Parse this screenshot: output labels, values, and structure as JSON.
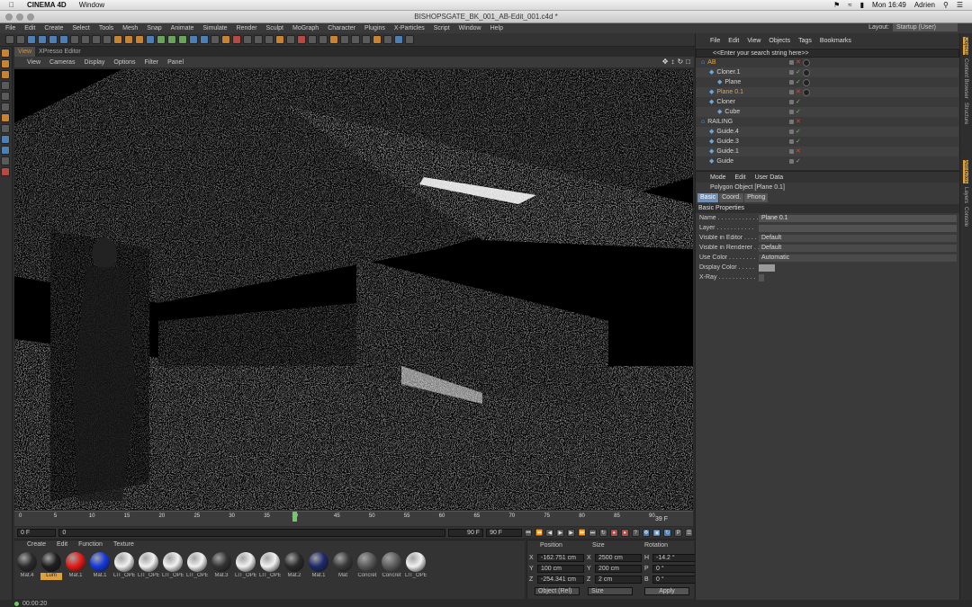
{
  "mac": {
    "app_name": "CINEMA 4D",
    "menu": [
      "Window"
    ],
    "clock": "Mon 16:49",
    "user": "Adrien"
  },
  "window_title": "BISHOPSGATE_BK_001_AB-Edit_001.c4d *",
  "main_menu": [
    "File",
    "Edit",
    "Create",
    "Select",
    "Tools",
    "Mesh",
    "Snap",
    "Animate",
    "Simulate",
    "Render",
    "Sculpt",
    "MoGraph",
    "Character",
    "Plugins",
    "X-Particles",
    "Script",
    "Window",
    "Help"
  ],
  "layout": {
    "label": "Layout:",
    "value": "Startup (User)"
  },
  "viewport": {
    "tabs": [
      "View",
      "XPresso Editor"
    ],
    "menu": [
      "View",
      "Cameras",
      "Display",
      "Options",
      "Filter",
      "Panel"
    ]
  },
  "timeline": {
    "ticks": [
      "0",
      "5",
      "10",
      "15",
      "20",
      "25",
      "30",
      "35",
      "39",
      "45",
      "50",
      "55",
      "60",
      "65",
      "70",
      "75",
      "80",
      "85",
      "90"
    ],
    "current_frame": 39,
    "end_label": "39 F"
  },
  "playback": {
    "start": "0 F",
    "min": "0",
    "max": "90 F",
    "end": "90 F"
  },
  "materials": {
    "menu": [
      "Create",
      "Edit",
      "Function",
      "Texture"
    ],
    "items": [
      {
        "name": "Mat.4",
        "color": "#2a2a2a"
      },
      {
        "name": "Lum",
        "color": "#1e1e1e",
        "selected": true
      },
      {
        "name": "Mat.1",
        "color": "#e41b17"
      },
      {
        "name": "Mat.1",
        "color": "#1438e0"
      },
      {
        "name": "LIT_OPE",
        "color": "#f2f2f2"
      },
      {
        "name": "LIT_OPE",
        "color": "#f2f2f2"
      },
      {
        "name": "LIT_OPE",
        "color": "#f2f2f2"
      },
      {
        "name": "LIT_OPE",
        "color": "#f2f2f2"
      },
      {
        "name": "Mat.3",
        "color": "#333333"
      },
      {
        "name": "LIT_OPE",
        "color": "#f2f2f2"
      },
      {
        "name": "LIT_OPE",
        "color": "#f2f2f2"
      },
      {
        "name": "Mat.2",
        "color": "#2a2a2a"
      },
      {
        "name": "Mat.1",
        "color": "#1c2a6b"
      },
      {
        "name": "Mat",
        "color": "#3a3a3a"
      },
      {
        "name": "Concret",
        "color": "#5a5a5a"
      },
      {
        "name": "Concret",
        "color": "#5e5e5e"
      },
      {
        "name": "LIT_OPE",
        "color": "#f2f2f2"
      }
    ]
  },
  "coords": {
    "headers": [
      "Position",
      "Size",
      "Rotation"
    ],
    "rows": [
      {
        "ax1": "X",
        "pos": "-162.751 cm",
        "ax2": "X",
        "size": "2500 cm",
        "ax3": "H",
        "rot": "-14.2 °"
      },
      {
        "ax1": "Y",
        "pos": "100 cm",
        "ax2": "Y",
        "size": "200 cm",
        "ax3": "P",
        "rot": "0 °"
      },
      {
        "ax1": "Z",
        "pos": "-254.341 cm",
        "ax2": "Z",
        "size": "2 cm",
        "ax3": "B",
        "rot": "0 °"
      }
    ],
    "mode1": "Object (Rel)",
    "mode2": "Size",
    "apply": "Apply"
  },
  "status": {
    "time": "00:00:20"
  },
  "objects": {
    "menu": [
      "File",
      "Edit",
      "View",
      "Objects",
      "Tags",
      "Bookmarks"
    ],
    "search_placeholder": "<<Enter your search string here>>",
    "rows": [
      {
        "name": "AB",
        "indent": 0,
        "hl": true
      },
      {
        "name": "Cloner.1",
        "indent": 1
      },
      {
        "name": "Plane",
        "indent": 2
      },
      {
        "name": "Plane 0.1",
        "indent": 1,
        "hl": true
      },
      {
        "name": "Cloner",
        "indent": 1
      },
      {
        "name": "Cube",
        "indent": 2
      },
      {
        "name": "RAILING",
        "indent": 0
      },
      {
        "name": "Guide.4",
        "indent": 1
      },
      {
        "name": "Guide.3",
        "indent": 1
      },
      {
        "name": "Guide.1",
        "indent": 1
      },
      {
        "name": "Guide",
        "indent": 1
      }
    ]
  },
  "attributes": {
    "menu": [
      "Mode",
      "Edit",
      "User Data"
    ],
    "title": "Polygon Object [Plane 0.1]",
    "tabs": [
      "Basic",
      "Coord.",
      "Phong"
    ],
    "section": "Basic Properties",
    "rows": [
      {
        "label": "Name . . . . . . . . . . . .",
        "value": "Plane 0.1"
      },
      {
        "label": "Layer . . . . . . . . . . .",
        "value": ""
      },
      {
        "label": "Visible in Editor . . . .",
        "value": "Default"
      },
      {
        "label": "Visible in Renderer . .",
        "value": "Default"
      },
      {
        "label": "Use Color . . . . . . . .",
        "value": "Automatic"
      },
      {
        "label": "Display Color . . . . .",
        "value": ""
      },
      {
        "label": "X-Ray . . . . . . . . . . .",
        "value": ""
      }
    ]
  },
  "right_tabs": [
    "Objects",
    "Content Browser",
    "Structure",
    "Attributes",
    "Layers",
    "Console"
  ]
}
